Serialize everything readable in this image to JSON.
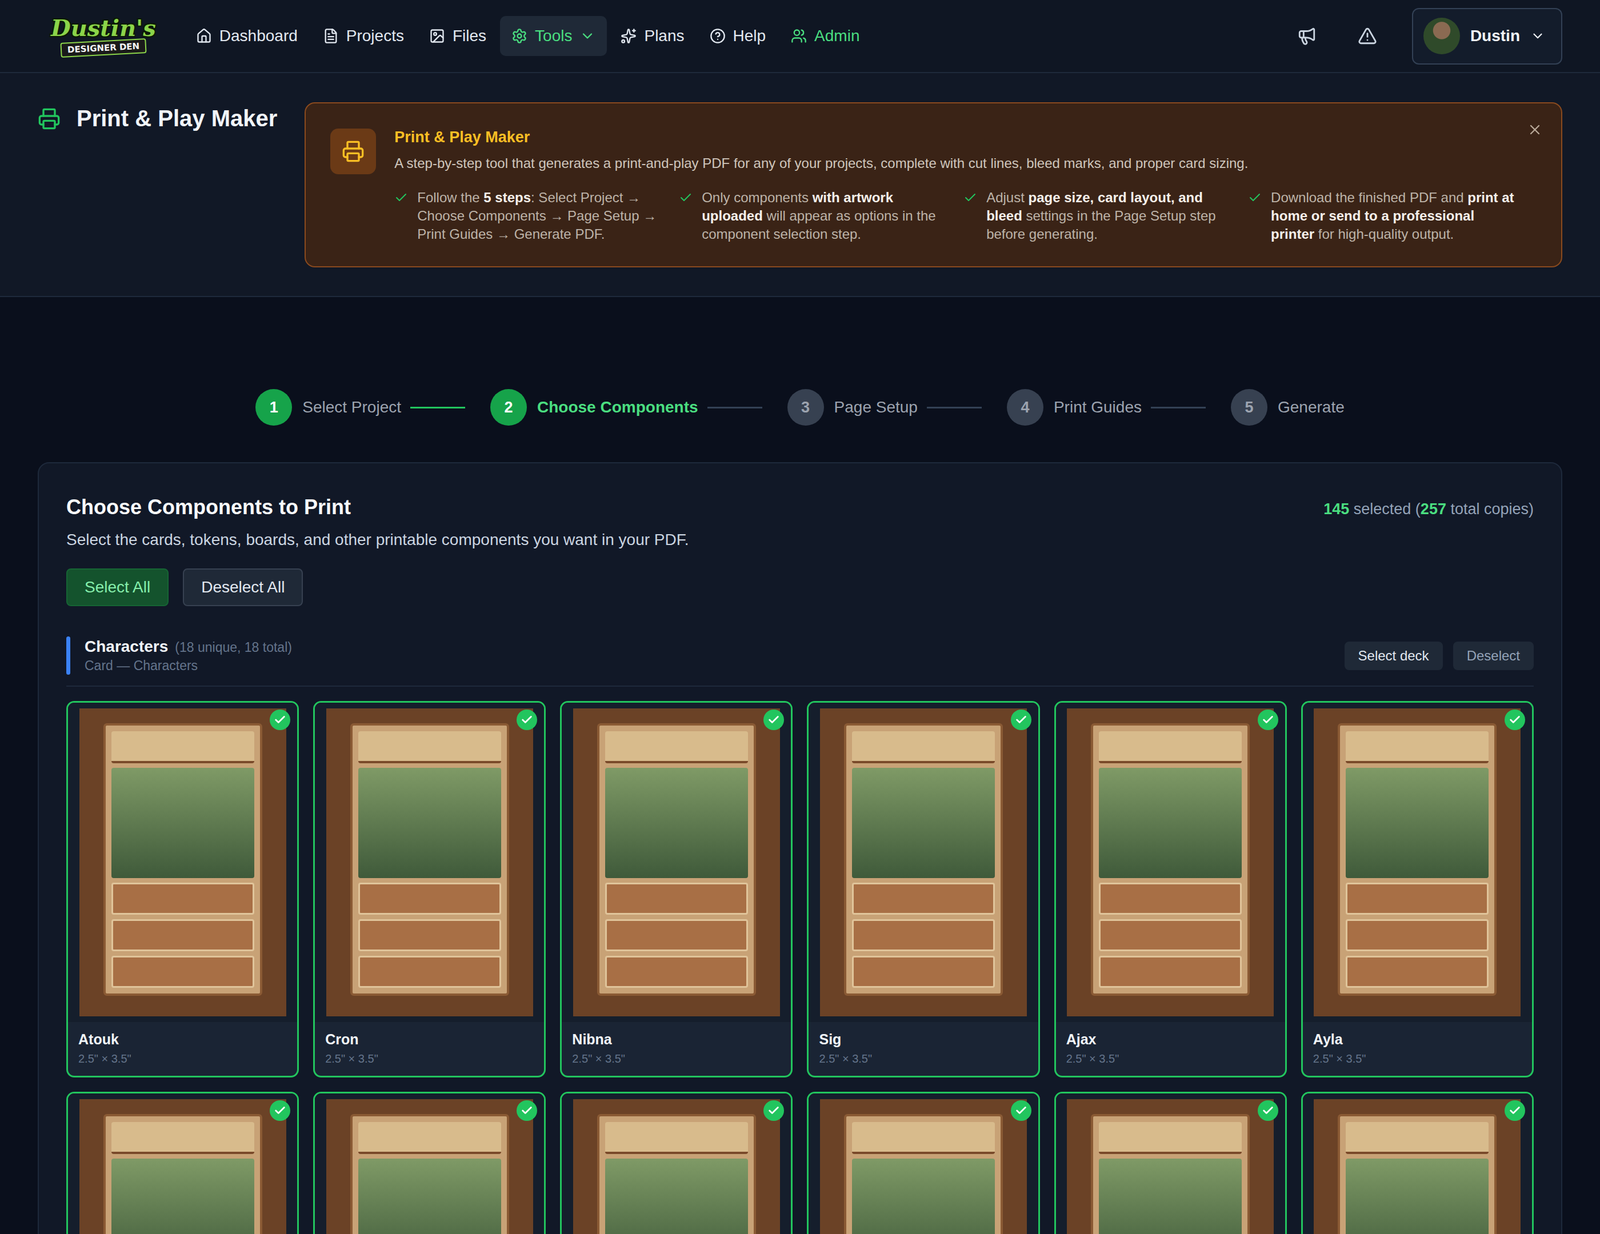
{
  "nav": {
    "logo": {
      "line1": "Dustin's",
      "line2": "DESIGNER DEN"
    },
    "items": [
      {
        "label": "Dashboard",
        "kind": "link",
        "selected": false,
        "color": "#e2e8f0"
      },
      {
        "label": "Projects",
        "kind": "link",
        "selected": false,
        "color": "#e2e8f0"
      },
      {
        "label": "Files",
        "kind": "link",
        "selected": false,
        "color": "#e2e8f0"
      },
      {
        "label": "Tools",
        "kind": "dropdown",
        "selected": true,
        "color": "#4ade80"
      },
      {
        "label": "Plans",
        "kind": "link",
        "selected": false,
        "color": "#e2e8f0"
      },
      {
        "label": "Help",
        "kind": "link",
        "selected": false,
        "color": "#e2e8f0"
      },
      {
        "label": "Admin",
        "kind": "link",
        "selected": false,
        "color": "#4ade80"
      }
    ],
    "user": {
      "name": "Dustin"
    }
  },
  "header": {
    "title": "Print & Play Maker"
  },
  "info": {
    "title": "Print & Play Maker",
    "description": "A step-by-step tool that generates a print-and-play PDF for any of your projects, complete with cut lines, bleed marks, and proper card sizing.",
    "bullets": [
      [
        {
          "text": "Follow the ",
          "bold": false
        },
        {
          "text": "5 steps",
          "bold": true
        },
        {
          "text": ": Select Project → Choose Components → Page Setup → Print Guides → Generate PDF.",
          "bold": false
        }
      ],
      [
        {
          "text": "Only components ",
          "bold": false
        },
        {
          "text": "with artwork uploaded",
          "bold": true
        },
        {
          "text": " will appear as options in the component selection step.",
          "bold": false
        }
      ],
      [
        {
          "text": "Adjust ",
          "bold": false
        },
        {
          "text": "page size, card layout, and bleed",
          "bold": true
        },
        {
          "text": " settings in the Page Setup step before generating.",
          "bold": false
        }
      ],
      [
        {
          "text": "Download the finished PDF and ",
          "bold": false
        },
        {
          "text": "print at home or send to a professional printer",
          "bold": true
        },
        {
          "text": " for high-quality output.",
          "bold": false
        }
      ]
    ]
  },
  "steps": [
    {
      "number": "1",
      "label": "Select Project",
      "completed": true,
      "selected": false
    },
    {
      "number": "2",
      "label": "Choose Components",
      "completed": false,
      "selected": true
    },
    {
      "number": "3",
      "label": "Page Setup",
      "completed": false,
      "selected": false
    },
    {
      "number": "4",
      "label": "Print Guides",
      "completed": false,
      "selected": false
    },
    {
      "number": "5",
      "label": "Generate",
      "completed": false,
      "selected": false
    }
  ],
  "panel": {
    "title": "Choose Components to Print",
    "count": {
      "selected": "145",
      "selected_label": " selected (",
      "copies": "257",
      "copies_label": " total copies)"
    },
    "subtitle": "Select the cards, tokens, boards, and other printable components you want in your PDF.",
    "buttons": [
      {
        "label": "Select All",
        "kind": "primary"
      },
      {
        "label": "Deselect All",
        "kind": "secondary"
      }
    ],
    "sections": [
      {
        "title": "Characters",
        "summary": "(18 unique, 18 total)",
        "subtitle": "Card — Characters",
        "actions": [
          {
            "label": "Select deck",
            "kind": "secondary"
          },
          {
            "label": "Deselect",
            "kind": "ghost"
          }
        ],
        "components": [
          {
            "name": "Atouk",
            "size": "2.5\" × 3.5\"",
            "selected": true
          },
          {
            "name": "Cron",
            "size": "2.5\" × 3.5\"",
            "selected": true
          },
          {
            "name": "Nibna",
            "size": "2.5\" × 3.5\"",
            "selected": true
          },
          {
            "name": "Sig",
            "size": "2.5\" × 3.5\"",
            "selected": true
          },
          {
            "name": "Ajax",
            "size": "2.5\" × 3.5\"",
            "selected": true
          },
          {
            "name": "Ayla",
            "size": "2.5\" × 3.5\"",
            "selected": true
          },
          {
            "selected": true
          },
          {
            "selected": true
          },
          {
            "selected": true
          },
          {
            "selected": true
          },
          {
            "selected": true
          },
          {
            "selected": true
          }
        ]
      }
    ]
  }
}
